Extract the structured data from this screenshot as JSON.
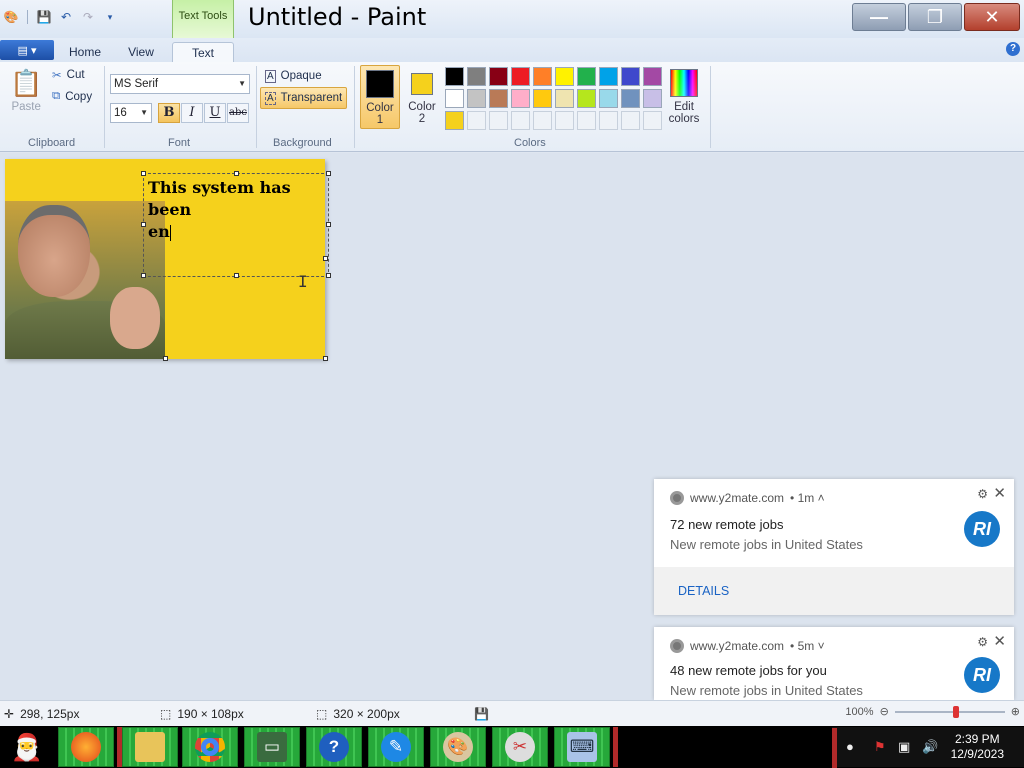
{
  "window": {
    "title": "Untitled - Paint",
    "context_tab": "Text Tools"
  },
  "tabs": [
    "Home",
    "View",
    "Text"
  ],
  "active_tab": "Text",
  "ribbon": {
    "clipboard": {
      "paste": "Paste",
      "cut": "Cut",
      "copy": "Copy",
      "label": "Clipboard"
    },
    "font": {
      "family": "MS Serif",
      "size": "16",
      "bold": "B",
      "italic": "I",
      "underline": "U",
      "strike": "abc",
      "label": "Font"
    },
    "background": {
      "opaque": "Opaque",
      "transparent": "Transparent",
      "label": "Background"
    },
    "colors": {
      "color1_label": "Color\n1",
      "color2_label": "Color\n2",
      "color1": "#000000",
      "color2": "#f5d11c",
      "edit_label": "Edit\ncolors",
      "label": "Colors",
      "palette_row1": [
        "#000000",
        "#7f7f7f",
        "#880015",
        "#ed1c24",
        "#ff7f27",
        "#fff200",
        "#22b14c",
        "#00a2e8",
        "#3f48cc",
        "#a349a4"
      ],
      "palette_row2": [
        "#ffffff",
        "#c3c3c3",
        "#b97a57",
        "#ffaec9",
        "#ffc90e",
        "#efe4b0",
        "#b5e61d",
        "#99d9ea",
        "#7092be",
        "#c8bfe7"
      ],
      "palette_row3": [
        "#f5d11c",
        "",
        "",
        "",
        "",
        "",
        "",
        "",
        "",
        ""
      ]
    }
  },
  "canvas": {
    "text": "This system has been\nen",
    "background": "#f5d11c"
  },
  "notifications": [
    {
      "source": "www.y2mate.com",
      "age": "• 1m ˄",
      "title": "72 new remote jobs",
      "body": "New remote jobs in United States",
      "logo": "RI",
      "action": "DETAILS"
    },
    {
      "source": "www.y2mate.com",
      "age": "• 5m ˅",
      "title": "48 new remote jobs for you",
      "body": "New remote jobs in United States",
      "logo": "RI"
    }
  ],
  "statusbar": {
    "cursor_pos": "298, 125px",
    "selection_size": "190 × 108px",
    "canvas_size": "320 × 200px",
    "zoom": "100%"
  },
  "taskbar": {
    "time": "2:39 PM",
    "date": "12/9/2023"
  }
}
